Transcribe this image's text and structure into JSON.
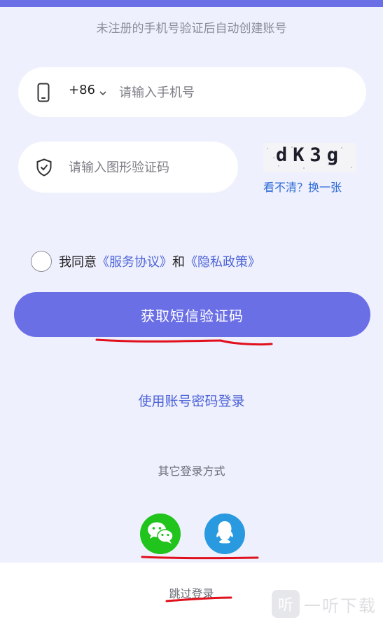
{
  "header": {
    "hint": "未注册的手机号验证后自动创建账号"
  },
  "phone": {
    "country_code": "+86",
    "placeholder": "请输入手机号"
  },
  "captcha": {
    "placeholder": "请输入图形验证码",
    "image_text": "dK3g",
    "refresh_label": "看不清？换一张"
  },
  "agreement": {
    "prefix": "我同意",
    "service_link": "《服务协议》",
    "conjunction": "和",
    "privacy_link": "《隐私政策》"
  },
  "actions": {
    "get_code": "获取短信验证码",
    "password_login": "使用账号密码登录",
    "other_methods": "其它登录方式",
    "skip": "跳过登录"
  },
  "social": [
    "wechat-icon",
    "qq-icon"
  ],
  "watermark": {
    "logo_char": "听",
    "text": "一听下载"
  },
  "colors": {
    "primary": "#6b6fe6",
    "link": "#4d63d8",
    "wechat": "#20c41c",
    "qq": "#2a9ae0",
    "annotation": "#e0101c"
  }
}
